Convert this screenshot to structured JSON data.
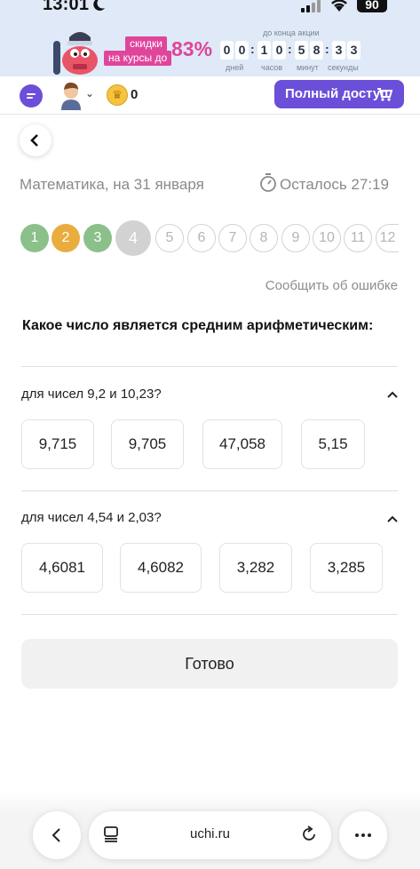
{
  "status_bar": {
    "time": "13:01",
    "battery": "90"
  },
  "promo": {
    "label_line1": "скидки",
    "label_line2": "на курсы до",
    "percent": "83%",
    "timer_caption": "до конца акции",
    "digits": [
      "0",
      "0",
      "1",
      "0",
      "5",
      "8",
      "3",
      "3"
    ],
    "units": [
      "дней",
      "часов",
      "минут",
      "секунды"
    ],
    "accent_color": "#e0459c"
  },
  "header": {
    "coins": "0",
    "full_access_label": "Полный доступ",
    "brand_color": "#6b4fd8"
  },
  "test": {
    "subject": "Математика, на 31 января",
    "remaining": "Осталось 27:19",
    "pills": [
      {
        "n": "1",
        "state": "correct",
        "color": "#8cc08a"
      },
      {
        "n": "2",
        "state": "partial",
        "color": "#e9ad3f"
      },
      {
        "n": "3",
        "state": "correct",
        "color": "#8cc08a"
      },
      {
        "n": "4",
        "state": "current"
      },
      {
        "n": "5",
        "state": "todo"
      },
      {
        "n": "6",
        "state": "todo"
      },
      {
        "n": "7",
        "state": "todo"
      },
      {
        "n": "8",
        "state": "todo"
      },
      {
        "n": "9",
        "state": "todo"
      },
      {
        "n": "10",
        "state": "todo"
      },
      {
        "n": "11",
        "state": "todo"
      },
      {
        "n": "12",
        "state": "todo"
      }
    ],
    "report_label": "Сообщить об ошибке",
    "question": "Какое число является средним арифметическим:",
    "subquestions": [
      {
        "text": "для чисел 9,2 и 10,23?",
        "options": [
          "9,715",
          "9,705",
          "47,058",
          "5,15"
        ]
      },
      {
        "text": "для чисел 4,54 и 2,03?",
        "options": [
          "4,6081",
          "4,6082",
          "3,282",
          "3,285"
        ]
      }
    ],
    "done_label": "Готово"
  },
  "browser": {
    "url": "uchi.ru"
  }
}
